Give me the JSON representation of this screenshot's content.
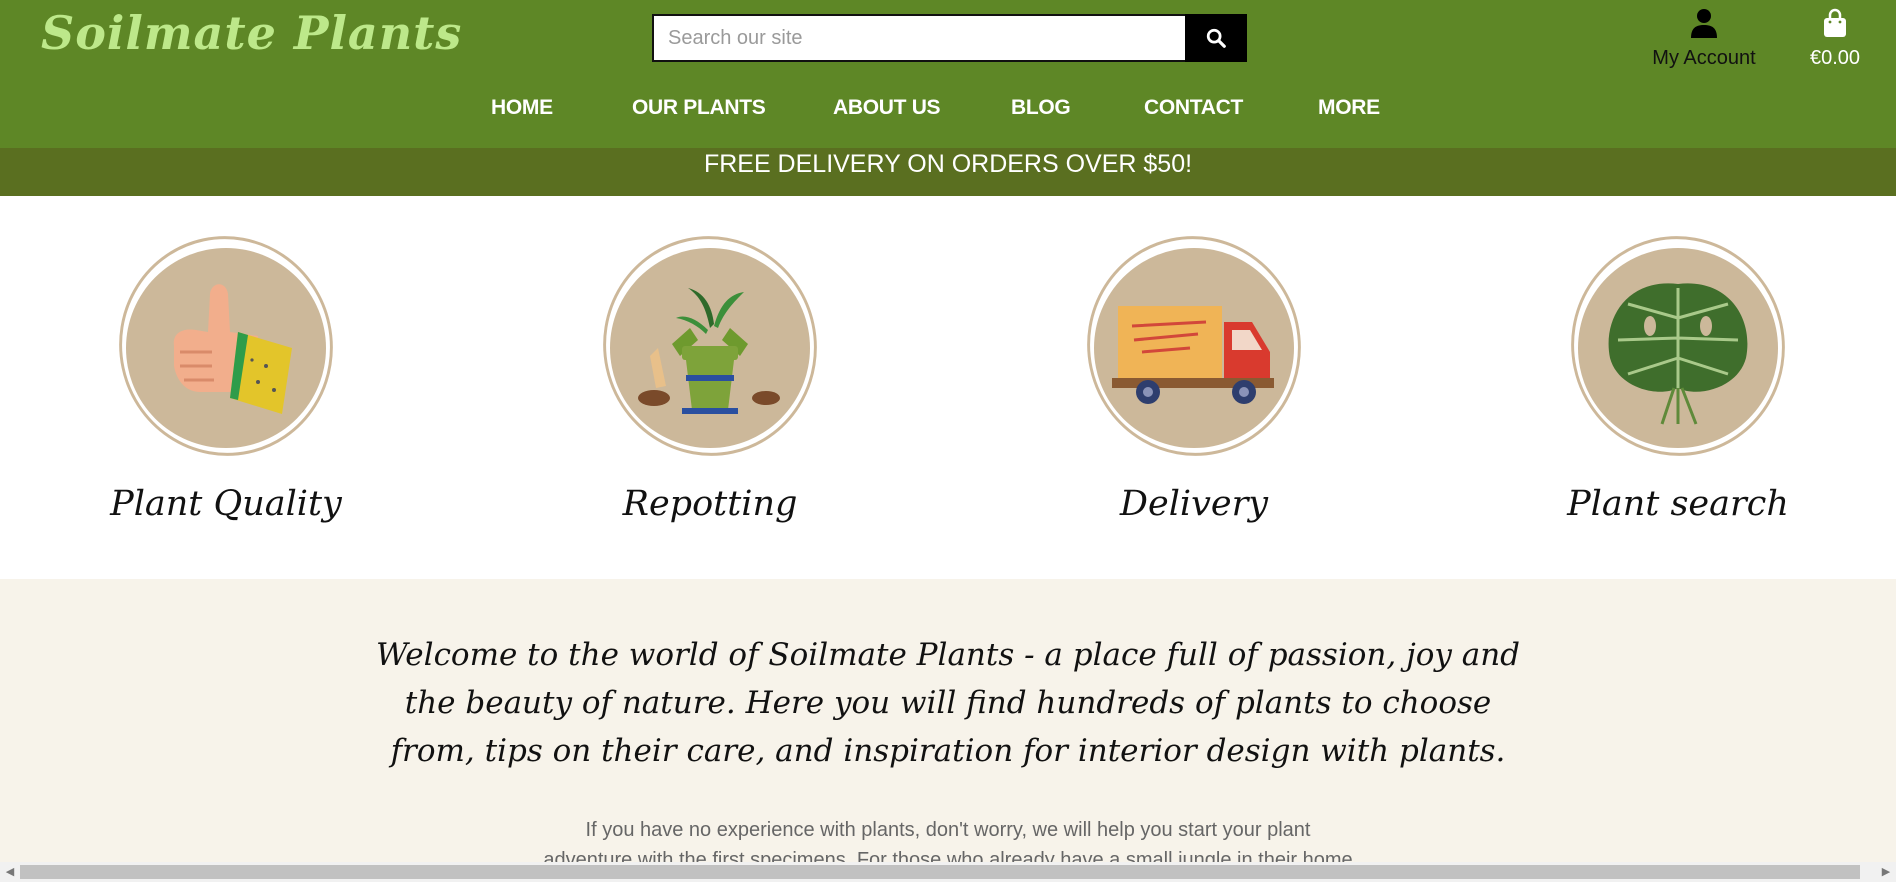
{
  "header": {
    "logo": "Soilmate Plants",
    "search_placeholder": "Search our site",
    "account_label": "My Account",
    "cart_total": "€0.00"
  },
  "nav": {
    "items": [
      "HOME",
      "OUR PLANTS",
      "ABOUT US",
      "BLOG",
      "CONTACT",
      "MORE"
    ]
  },
  "banner": {
    "text": "FREE DELIVERY ON ORDERS OVER $50!"
  },
  "features": [
    {
      "title": "Plant Quality",
      "icon": "thumbs-up-icon"
    },
    {
      "title": "Repotting",
      "icon": "potted-plant-icon"
    },
    {
      "title": "Delivery",
      "icon": "delivery-truck-icon"
    },
    {
      "title": "Plant search",
      "icon": "monstera-leaf-icon"
    }
  ],
  "welcome": {
    "heading": "Welcome to the world of Soilmate Plants - a place full of passion, joy and the beauty of nature. Here you will find hundreds of plants to choose from, tips on their care, and inspiration for interior design with plants.",
    "body": "If you have no experience with plants, don't worry, we will help you start your plant adventure with the first specimens. For those who already have a small jungle in their home"
  },
  "colors": {
    "header_bg": "#5e8726",
    "banner_bg": "#5a6f20",
    "logo": "#bde88a",
    "circle": "#ccb89a",
    "welcome_bg": "#f7f3ea"
  }
}
